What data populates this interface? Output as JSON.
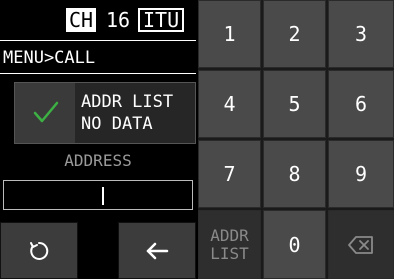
{
  "status_bar": {
    "ch_label": "CH",
    "channel": "16",
    "mode": "ITU"
  },
  "breadcrumb": "MENU>CALL",
  "addr_status": {
    "text": "ADDR LIST\nNO DATA",
    "icon": "check-icon",
    "icon_color": "#3cb043"
  },
  "address": {
    "label": "ADDRESS",
    "value": ""
  },
  "controls": {
    "reset_icon": "refresh-icon",
    "back_icon": "left-arrow-icon"
  },
  "keypad": {
    "keys": [
      "1",
      "2",
      "3",
      "4",
      "5",
      "6",
      "7",
      "8",
      "9"
    ],
    "addr_list_key": "ADDR\nLIST",
    "zero_key": "0",
    "delete_icon": "backspace-icon"
  }
}
